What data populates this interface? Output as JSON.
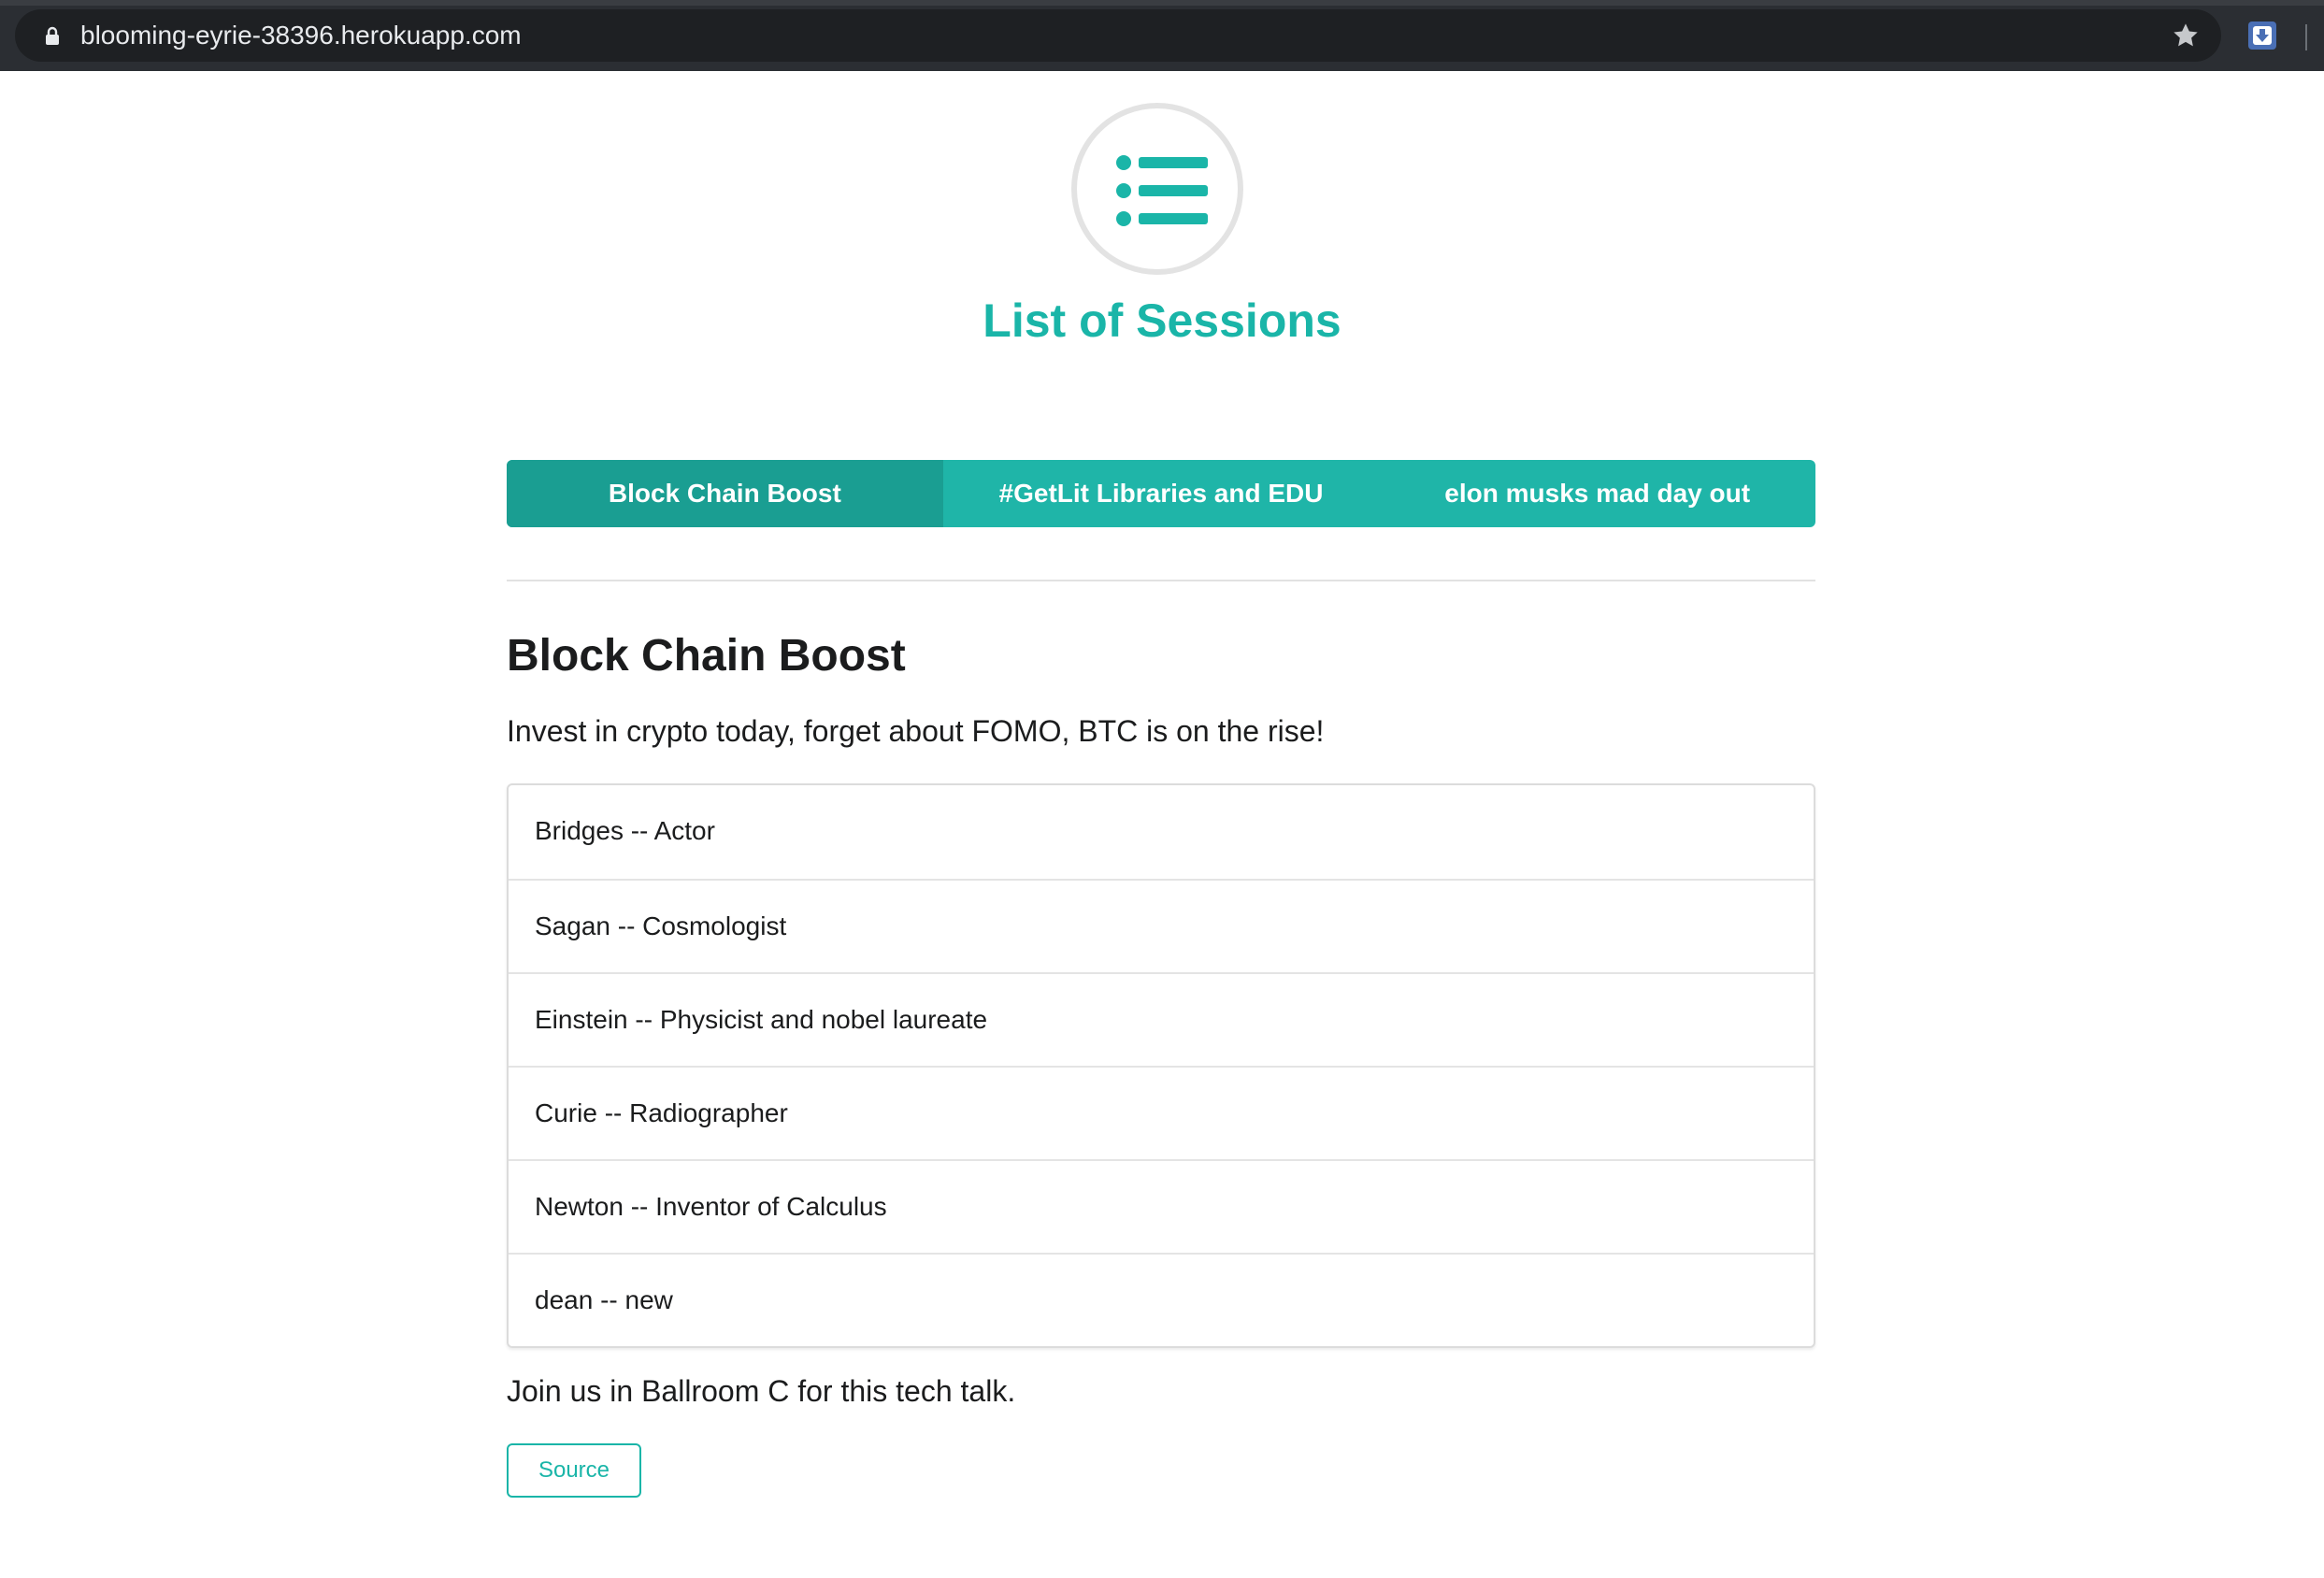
{
  "browser": {
    "url": "blooming-eyrie-38396.herokuapp.com",
    "lock_icon": "lock-icon",
    "bookmark_icon": "star-icon",
    "extension_icon": "download-extension-icon"
  },
  "header": {
    "logo_icon": "list-icon",
    "title": "List of Sessions"
  },
  "tabs": [
    {
      "label": "Block Chain Boost",
      "active": true
    },
    {
      "label": "#GetLit Libraries and EDU",
      "active": false
    },
    {
      "label": "elon musks mad day out",
      "active": false
    }
  ],
  "session": {
    "title": "Block Chain Boost",
    "description": "Invest in crypto today, forget about FOMO, BTC is on the rise!",
    "speakers": [
      "Bridges -- Actor",
      "Sagan -- Cosmologist",
      "Einstein -- Physicist and nobel laureate",
      "Curie -- Radiographer",
      "Newton -- Inventor of Calculus",
      "dean -- new"
    ],
    "footer": "Join us in Ballroom C for this tech talk.",
    "source_label": "Source"
  },
  "colors": {
    "accent": "#1ab5a8",
    "tab_bg": "#1fb5a8",
    "tab_active_bg": "#1a9e92",
    "text": "#1b1c1d",
    "browser_bar": "#2b2e33"
  }
}
